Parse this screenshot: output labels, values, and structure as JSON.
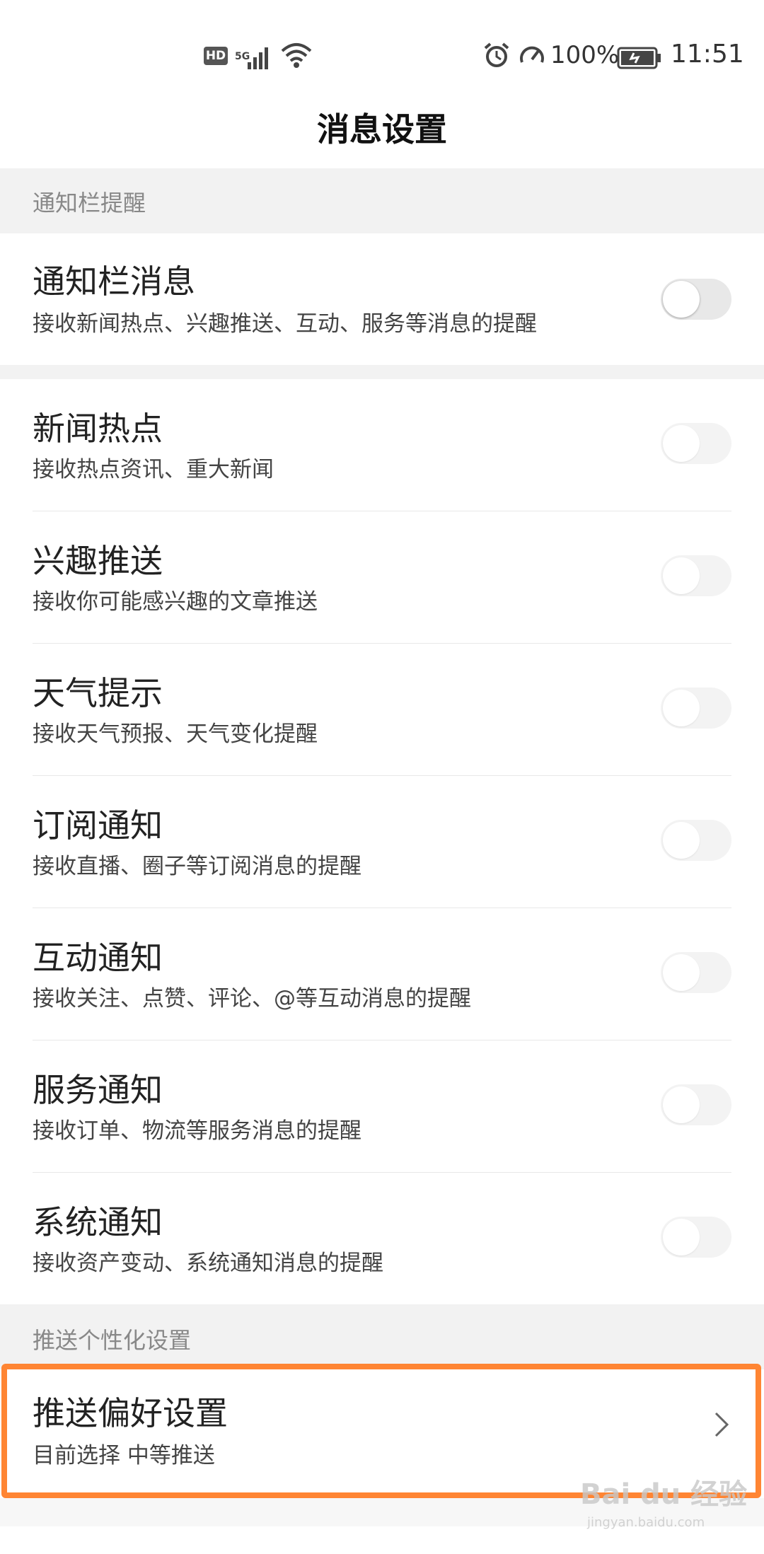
{
  "status_bar": {
    "hd": "HD",
    "network": "5G",
    "battery_percent": "100%",
    "time": "11:51",
    "icons": [
      "signal-icon",
      "wifi-icon",
      "alarm-icon",
      "speed-icon",
      "battery-charging-icon"
    ]
  },
  "page_title": "消息设置",
  "sections": {
    "notification_bar": {
      "header": "通知栏提醒"
    },
    "push_personalization": {
      "header": "推送个性化设置"
    }
  },
  "notification_master": {
    "title": "通知栏消息",
    "subtitle": "接收新闻热点、兴趣推送、互动、服务等消息的提醒",
    "enabled": false
  },
  "items": [
    {
      "title": "新闻热点",
      "subtitle": "接收热点资讯、重大新闻",
      "enabled": false
    },
    {
      "title": "兴趣推送",
      "subtitle": "接收你可能感兴趣的文章推送",
      "enabled": false
    },
    {
      "title": "天气提示",
      "subtitle": "接收天气预报、天气变化提醒",
      "enabled": false
    },
    {
      "title": "订阅通知",
      "subtitle": "接收直播、圈子等订阅消息的提醒",
      "enabled": false
    },
    {
      "title": "互动通知",
      "subtitle": "接收关注、点赞、评论、@等互动消息的提醒",
      "enabled": false
    },
    {
      "title": "服务通知",
      "subtitle": "接收订单、物流等服务消息的提醒",
      "enabled": false
    },
    {
      "title": "系统通知",
      "subtitle": "接收资产变动、系统通知消息的提醒",
      "enabled": false
    }
  ],
  "push_preference": {
    "title": "推送偏好设置",
    "subtitle": "目前选择 中等推送"
  },
  "watermark": {
    "brand": "Bai du 经验",
    "url": "jingyan.baidu.com"
  },
  "colors": {
    "highlight": "#ff8533",
    "section_bg": "#f2f2f2",
    "toggle_off": "#e8e8e8"
  }
}
